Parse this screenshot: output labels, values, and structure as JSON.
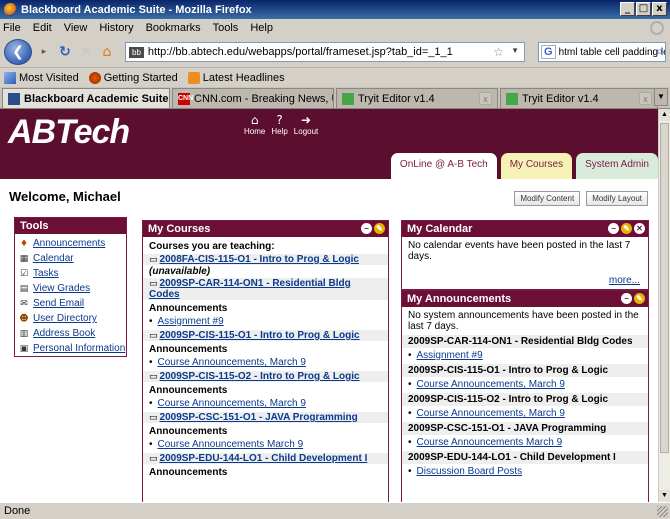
{
  "window": {
    "title": "Blackboard Academic Suite - Mozilla Firefox",
    "min": "_",
    "max": "□",
    "close": "x"
  },
  "menu": [
    "File",
    "Edit",
    "View",
    "History",
    "Bookmarks",
    "Tools",
    "Help"
  ],
  "nav": {
    "url": "http://bb.abtech.edu/webapps/portal/frameset.jsp?tab_id=_1_1",
    "search_text": "html table cell padding le",
    "search_engine": "G"
  },
  "bookmarks": [
    "Most Visited",
    "Getting Started",
    "Latest Headlines"
  ],
  "tabs": [
    {
      "label": "Blackboard Academic Suite",
      "active": true
    },
    {
      "label": "CNN.com - Breaking News, U.S.,...",
      "active": false
    },
    {
      "label": "Tryit Editor v1.4",
      "active": false
    },
    {
      "label": "Tryit Editor v1.4",
      "active": false
    }
  ],
  "portal": {
    "logo": "ABTech",
    "header_links": [
      "Home",
      "Help",
      "Logout"
    ],
    "nav_tabs": [
      "OnLine @ A-B Tech",
      "My Courses",
      "System Admin"
    ],
    "welcome": "Welcome, Michael",
    "modify_content": "Modify Content",
    "modify_layout": "Modify Layout"
  },
  "tools": {
    "title": "Tools",
    "items": [
      "Announcements",
      "Calendar",
      "Tasks",
      "View Grades",
      "Send Email",
      "User Directory",
      "Address Book",
      "Personal Information"
    ]
  },
  "courses": {
    "title": "My Courses",
    "teaching_label": "Courses you are teaching:",
    "unavailable": "(unavailable)",
    "announcements_label": "Announcements",
    "list": [
      "2008FA-CIS-115-O1 - Intro to Prog & Logic",
      "2009SP-CAR-114-ON1 - Residential Bldg Codes",
      "2009SP-CIS-115-O1 - Intro to Prog & Logic",
      "2009SP-CIS-115-O2 - Intro to Prog & Logic",
      "2009SP-CSC-151-O1 - JAVA Programming",
      "2009SP-EDU-144-LO1 - Child Development I"
    ],
    "announcements": [
      "Assignment #9",
      "Course Announcements, March 9",
      "Course Announcements, March 9",
      "Course Announcements March 9"
    ]
  },
  "calendar": {
    "title": "My Calendar",
    "message": "No calendar events have been posted in the last 7 days.",
    "more": "more..."
  },
  "announcements": {
    "title": "My Announcements",
    "message": "No system announcements have been posted in the last 7 days.",
    "items": [
      {
        "course": "2009SP-CAR-114-ON1 - Residential Bldg Codes",
        "link": "Assignment #9"
      },
      {
        "course": "2009SP-CIS-115-O1 - Intro to Prog & Logic",
        "link": "Course Announcements, March 9"
      },
      {
        "course": "2009SP-CIS-115-O2 - Intro to Prog & Logic",
        "link": "Course Announcements, March 9"
      },
      {
        "course": "2009SP-CSC-151-O1 - JAVA Programming",
        "link": "Course Announcements March 9"
      },
      {
        "course": "2009SP-EDU-144-LO1 - Child Development I",
        "link": "Discussion Board Posts"
      }
    ]
  },
  "status": "Done"
}
